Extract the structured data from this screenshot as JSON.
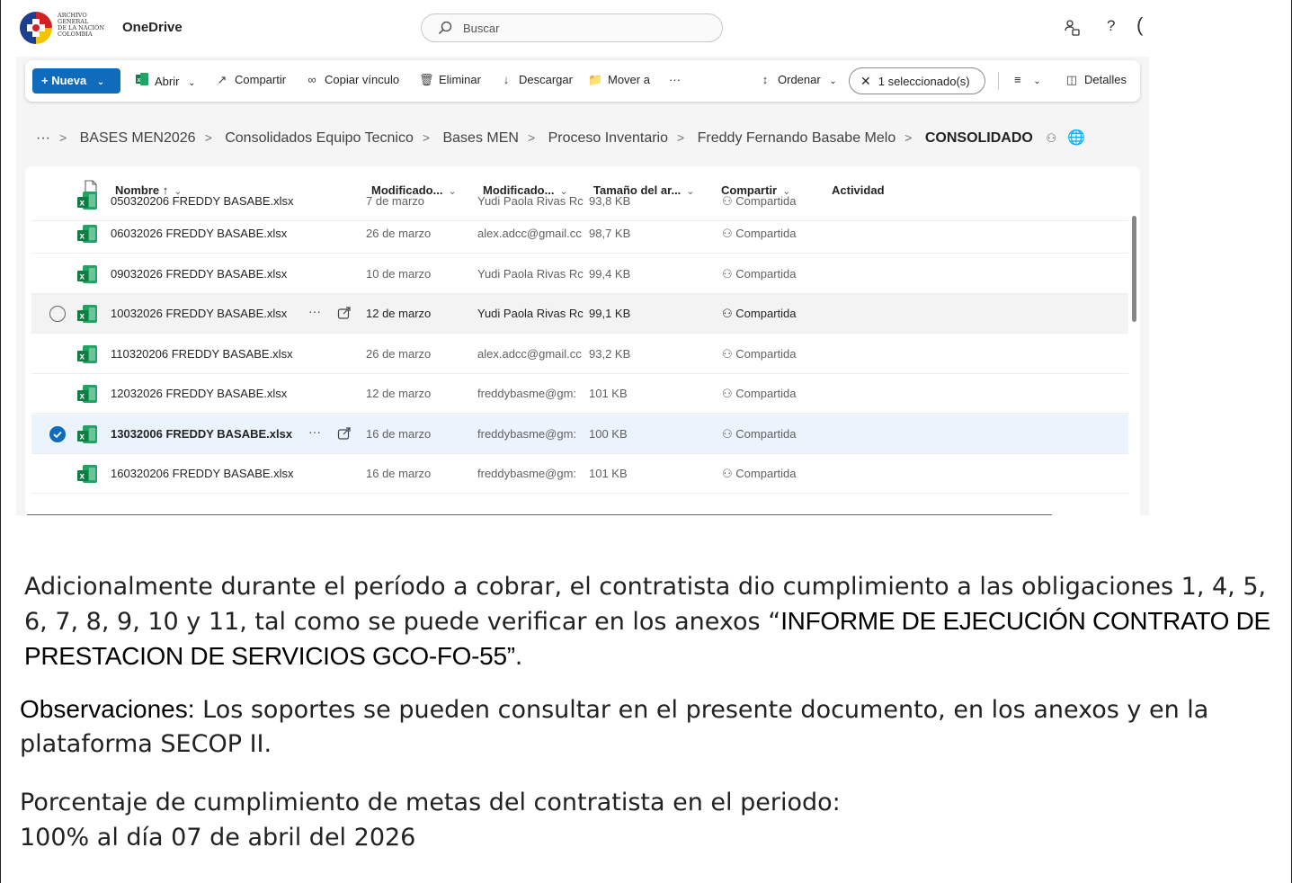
{
  "org": {
    "logo_lines": [
      "ARCHIVO",
      "GENERAL",
      "DE LA NACIÓN",
      "COLOMBIA"
    ]
  },
  "app": {
    "name": "OneDrive",
    "help": "?"
  },
  "search": {
    "placeholder": "Buscar"
  },
  "toolbar": {
    "new_label": "+ Nueva",
    "open": "Abrir",
    "share": "Compartir",
    "copy_link": "Copiar vínculo",
    "delete": "Eliminar",
    "download": "Descargar",
    "move": "Mover a",
    "more": "···",
    "sort": "Ordenar",
    "selection": "1 seleccionado(s)",
    "details": "Detalles"
  },
  "breadcrumb": {
    "more": "···",
    "items": [
      "BASES MEN2026",
      "Consolidados Equipo Tecnico",
      "Bases MEN",
      "Proceso Inventario",
      "Freddy Fernando Basabe Melo"
    ],
    "current": "CONSOLIDADO"
  },
  "columns": [
    "Nombre ↑",
    "Modificado...",
    "Modificado...",
    "Tamaño del ar...",
    "Compartir",
    "Actividad"
  ],
  "files": [
    {
      "name": "050320206 FREDDY BASABE.xlsx",
      "modified": "7 de marzo",
      "modified_by": "Yudi Paola Rivas Rc",
      "size": "93,8 KB",
      "sharing": "Compartida"
    },
    {
      "name": "06032026 FREDDY BASABE.xlsx",
      "modified": "26 de marzo",
      "modified_by": "alex.adcc@gmail.cc",
      "size": "98,7 KB",
      "sharing": "Compartida"
    },
    {
      "name": "09032026 FREDDY BASABE.xlsx",
      "modified": "10 de marzo",
      "modified_by": "Yudi Paola Rivas Rc",
      "size": "99,4 KB",
      "sharing": "Compartida"
    },
    {
      "name": "10032026 FREDDY BASABE.xlsx",
      "modified": "12 de marzo",
      "modified_by": "Yudi Paola Rivas Rc",
      "size": "99,1 KB",
      "sharing": "Compartida"
    },
    {
      "name": "110320206 FREDDY BASABE.xlsx",
      "modified": "26 de marzo",
      "modified_by": "alex.adcc@gmail.cc",
      "size": "93,2 KB",
      "sharing": "Compartida"
    },
    {
      "name": "12032026 FREDDY BASABE.xlsx",
      "modified": "12 de marzo",
      "modified_by": "freddybasme@gm:",
      "size": "101 KB",
      "sharing": "Compartida"
    },
    {
      "name": "13032006 FREDDY BASABE.xlsx",
      "modified": "16 de marzo",
      "modified_by": "freddybasme@gm:",
      "size": "100 KB",
      "sharing": "Compartida"
    },
    {
      "name": "160320206 FREDDY BASABE.xlsx",
      "modified": "16 de marzo",
      "modified_by": "freddybasme@gm:",
      "size": "101 KB",
      "sharing": "Compartida"
    }
  ],
  "row_more": "···",
  "document": {
    "para_text": "Adicionalmente durante el período a cobrar, el contratista dio cumplimiento a las obligaciones 1, 4, 5, 6, 7, 8, 9, 10 y 11, tal como se puede verificar en los anexos “",
    "para_highlight": "INFORME DE EJECUCIÓN CONTRATO DE PRESTACION DE SERVICIOS GCO-FO-55”",
    "para_end": ".",
    "obs_label": "Observaciones:",
    "obs_text": " Los soportes se pueden consultar en el presente documento, en los anexos y en la plataforma SECOP II.",
    "pct_line1": "Porcentaje de cumplimiento de metas del contratista en el periodo:",
    "pct_line2": "100% al día 07 de abril del 2026"
  },
  "colors": {
    "accent": "#0f6cbd",
    "excel": "#107c41",
    "selected_row": "#ebf3fc"
  }
}
